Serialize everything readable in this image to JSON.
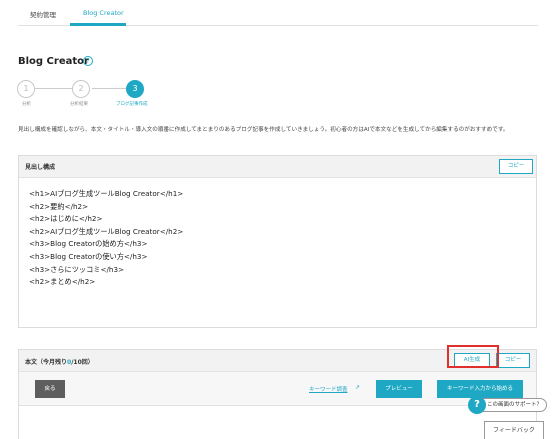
{
  "tabs": [
    {
      "label": "契約管理",
      "active": false
    },
    {
      "label": "Blog Creator",
      "active": true
    }
  ],
  "page": {
    "title": "Blog Creator",
    "help_icon": "?"
  },
  "steps": [
    {
      "num": "1",
      "label": "分析",
      "active": false
    },
    {
      "num": "2",
      "label": "分析結果",
      "active": false
    },
    {
      "num": "3",
      "label": "ブログ記事作成",
      "active": true
    }
  ],
  "description": "見出し構成を確認しながら、本文・タイトル・導入文の順番に作成してまとまりのあるブログ記事を作成していきましょう。初心者の方はAIで本文などを生成してから編集するのがおすすめです。",
  "headings_panel": {
    "title": "見出し構成",
    "copy_label": "コピー",
    "lines": [
      "<h1>AIブログ生成ツールBlog Creator</h1>",
      "<h2>要約</h2>",
      "<h2>はじめに</h2>",
      "<h2>AIブログ生成ツールBlog Creator</h2>",
      "<h3>Blog Creatorの始め方</h3>",
      "<h3>Blog Creatorの使い方</h3>",
      "<h3>さらにツッコミ</h3>",
      "<h2>まとめ</h2>"
    ]
  },
  "body_panel": {
    "title_prefix": "本文（今月残り",
    "remaining": "0",
    "title_suffix": "/10回）",
    "ai_button": "AI生成",
    "copy_label": "コピー",
    "back_button": "戻る",
    "keyword_link": "キーワード調査",
    "preview_button": "プレビュー",
    "start_keyword_button": "キーワード入力から始める"
  },
  "support": {
    "label": "この画面のサポート？",
    "icon": "?"
  },
  "feedback": "フィードバック",
  "colors": {
    "accent": "#1fa8c4",
    "highlight": "#e0302c"
  }
}
